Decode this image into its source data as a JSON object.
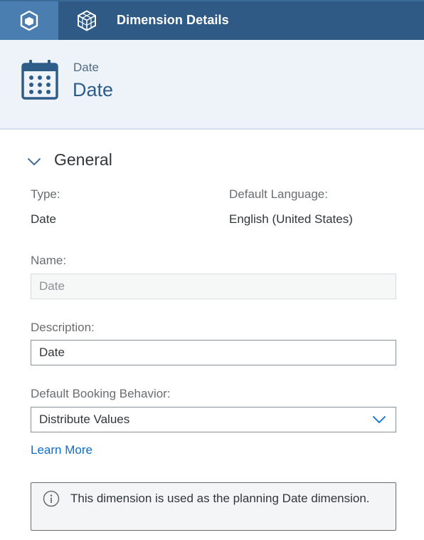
{
  "topbar": {
    "home_icon": "cube-icon",
    "tab_icon": "cubes-icon",
    "tab_title": "Dimension Details"
  },
  "header": {
    "icon": "calendar-icon",
    "subtitle": "Date",
    "title": "Date"
  },
  "section": {
    "toggle_icon": "chevron-down-icon",
    "title": "General"
  },
  "fields": {
    "type_label": "Type:",
    "type_value": "Date",
    "language_label": "Default Language:",
    "language_value": "English (United States)",
    "name_label": "Name:",
    "name_value": "Date",
    "description_label": "Description:",
    "description_value": "Date",
    "booking_label": "Default Booking Behavior:",
    "booking_value": "Distribute Values"
  },
  "learn_more": "Learn More",
  "info": {
    "icon": "info-icon",
    "text": "This dimension is used as the planning Date dimension."
  },
  "colors": {
    "shell": "#2f5a85",
    "shell_active": "#4a7db0",
    "header_bg": "#edf3f8",
    "title": "#2e5d8a",
    "link": "#0a6ed1"
  }
}
